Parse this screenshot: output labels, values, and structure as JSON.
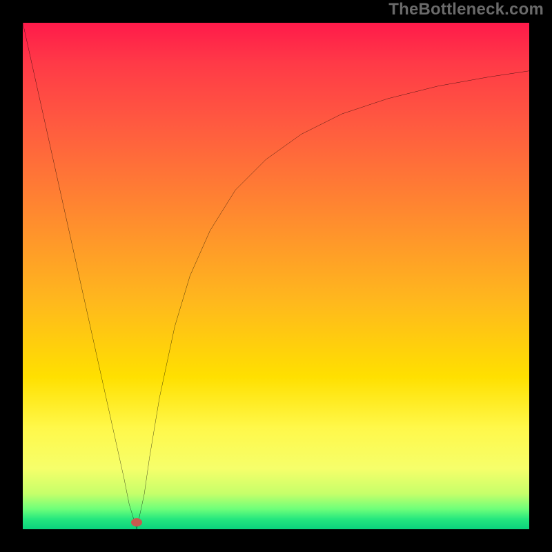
{
  "watermark": {
    "text": "TheBottleneck.com"
  },
  "marker": {
    "color": "#c75a4e",
    "x_pct": 22.5,
    "y_pct": 98.7
  },
  "chart_data": {
    "type": "line",
    "title": "",
    "xlabel": "",
    "ylabel": "",
    "xlim": [
      0,
      100
    ],
    "ylim": [
      0,
      100
    ],
    "grid": false,
    "legend": false,
    "background_gradient": {
      "direction": "vertical",
      "stops": [
        {
          "pos": 0.0,
          "color": "#ff1a4a"
        },
        {
          "pos": 0.08,
          "color": "#ff3a47"
        },
        {
          "pos": 0.2,
          "color": "#ff5a40"
        },
        {
          "pos": 0.38,
          "color": "#ff8a2f"
        },
        {
          "pos": 0.55,
          "color": "#ffb81d"
        },
        {
          "pos": 0.7,
          "color": "#ffe000"
        },
        {
          "pos": 0.8,
          "color": "#fff84a"
        },
        {
          "pos": 0.88,
          "color": "#f6ff6a"
        },
        {
          "pos": 0.93,
          "color": "#c6ff6a"
        },
        {
          "pos": 0.96,
          "color": "#6eff7a"
        },
        {
          "pos": 0.98,
          "color": "#25e77e"
        },
        {
          "pos": 1.0,
          "color": "#0ad37d"
        }
      ]
    },
    "series": [
      {
        "name": "bottleneck-curve",
        "color": "#000000",
        "x": [
          0.0,
          2,
          4,
          6,
          8,
          10,
          12,
          14,
          16,
          18,
          20,
          21,
          22.5,
          24,
          25,
          27,
          30,
          33,
          37,
          42,
          48,
          55,
          63,
          72,
          82,
          92,
          100
        ],
        "y": [
          100,
          91,
          82,
          73,
          64,
          55,
          46,
          37,
          28,
          19,
          10,
          5,
          0,
          7,
          14,
          26,
          40,
          50,
          59,
          67,
          73,
          78,
          82,
          85,
          87.5,
          89.3,
          90.5
        ]
      }
    ],
    "annotations": [
      {
        "type": "marker",
        "name": "min-point",
        "x": 22.5,
        "y": 1.3,
        "color": "#c75a4e",
        "shape": "ellipse"
      }
    ]
  }
}
